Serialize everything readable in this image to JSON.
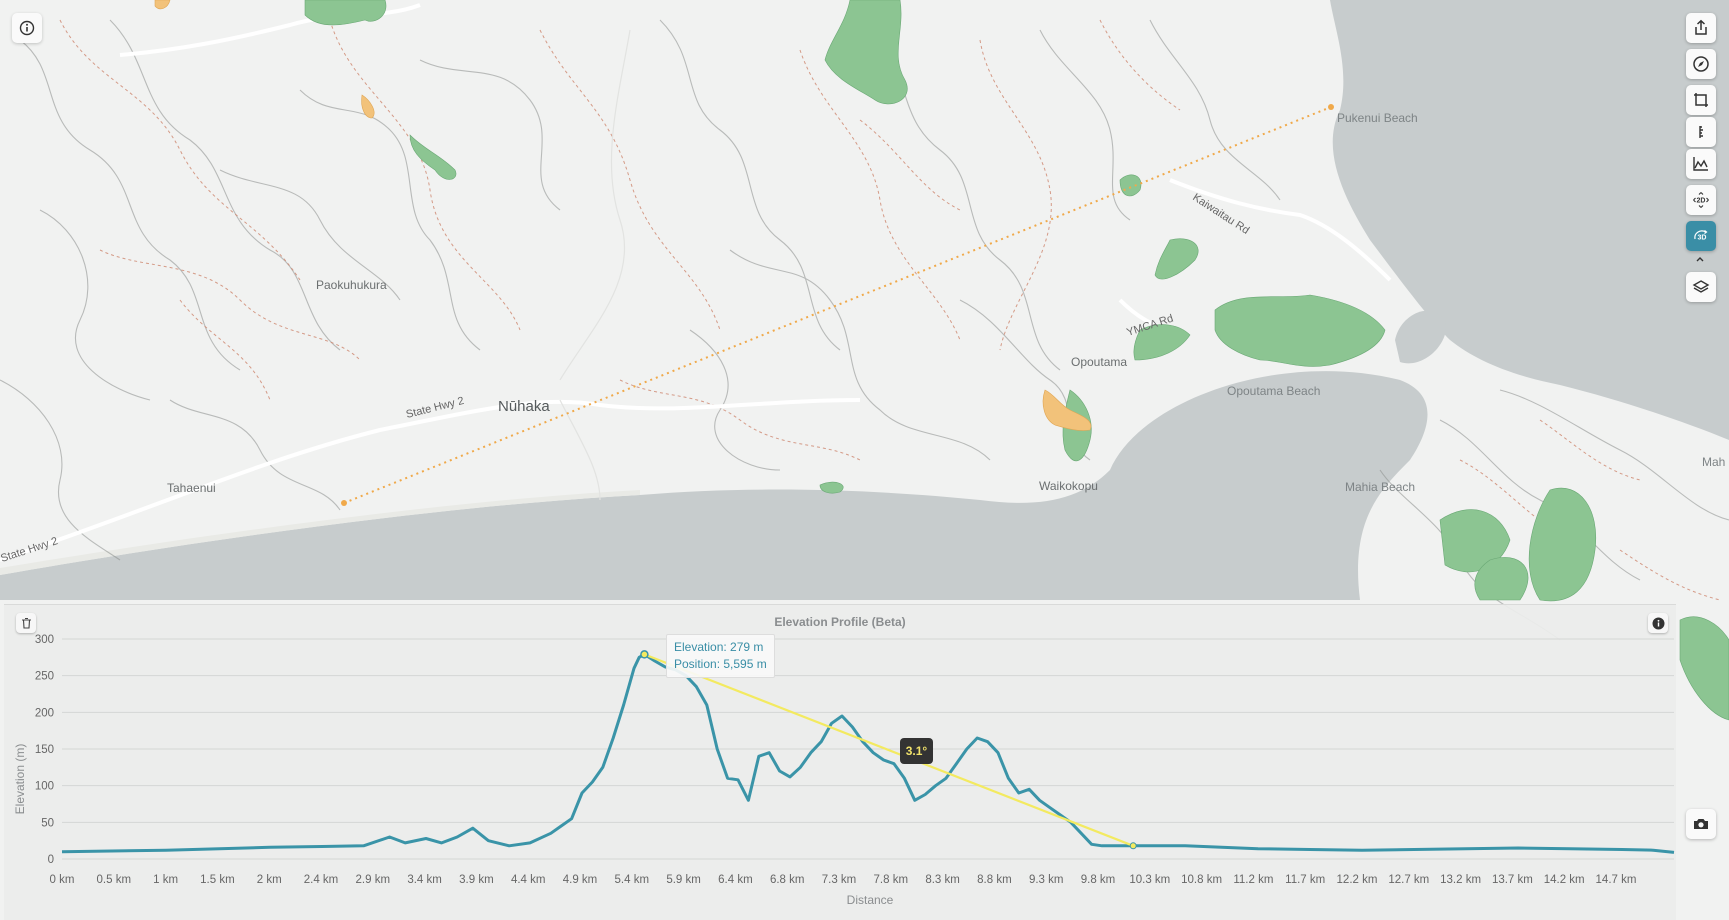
{
  "map": {
    "places": {
      "nuhaka": "Nūhaka",
      "paokuhukura": "Paokuhukura",
      "tahaenui": "Tahaenui",
      "opoutama": "Opoutama",
      "waikokopu": "Waikokopu",
      "pukenui_beach": "Pukenui Beach",
      "opoutama_beach": "Opoutama Beach",
      "mahia_beach": "Mahia Beach",
      "mah": "Mah"
    },
    "roads": {
      "state_hwy_2_a": "State Hwy 2",
      "state_hwy_2_b": "State Hwy 2",
      "kaiwaitau_rd": "Kaiwaitau Rd",
      "ymca_rd": "YMCA Rd"
    },
    "colors": {
      "land": "#f1f2f1",
      "sea": "#c7cccd",
      "forest": "#8cc592",
      "route": "#f0a94a"
    }
  },
  "controls": {
    "info_icon": "info-icon",
    "share_icon": "share-icon",
    "compass_icon": "compass-icon",
    "frame_icon": "frame-icon",
    "ruler_icon": "ruler-icon",
    "profile_icon": "elevation-profile-icon",
    "view_2d_label": "2D",
    "view_3d_label": "3D",
    "layers_icon": "layers-icon",
    "camera_icon": "camera-icon",
    "trash_icon": "trash-icon"
  },
  "elevation_panel": {
    "title": "Elevation Profile (Beta)",
    "tooltip": {
      "elevation": "Elevation: 279 m",
      "position": "Position: 5,595 m"
    },
    "slope_label": "3.1°",
    "colors": {
      "profile": "#3a94a8",
      "slope_line": "#f3ea60"
    }
  },
  "chart_data": {
    "type": "line",
    "xlabel": "Distance",
    "ylabel": "Elevation (m)",
    "xlim": [
      0,
      15.5
    ],
    "ylim": [
      0,
      300
    ],
    "y_ticks": [
      "0",
      "50",
      "100",
      "150",
      "200",
      "250",
      "300"
    ],
    "x_ticks": [
      "0 km",
      "0.5 km",
      "1 km",
      "1.5 km",
      "2 km",
      "2.4 km",
      "2.9 km",
      "3.4 km",
      "3.9 km",
      "4.4 km",
      "4.9 km",
      "5.4 km",
      "5.9 km",
      "6.4 km",
      "6.8 km",
      "7.3 km",
      "7.8 km",
      "8.3 km",
      "8.8 km",
      "9.3 km",
      "9.8 km",
      "10.3 km",
      "10.8 km",
      "11.2 km",
      "11.7 km",
      "12.2 km",
      "12.7 km",
      "13.2 km",
      "13.7 km",
      "14.2 km",
      "14.7 km"
    ],
    "grid": true,
    "series": [
      {
        "x": [
          0,
          1,
          2,
          2.5,
          2.9,
          3.15,
          3.3,
          3.5,
          3.65,
          3.8,
          3.95,
          4.1,
          4.3,
          4.5,
          4.7,
          4.8,
          4.9,
          5.0,
          5.1,
          5.2,
          5.3,
          5.4,
          5.5,
          5.55,
          5.6,
          5.7,
          5.8,
          5.9,
          6.0,
          6.1,
          6.2,
          6.3,
          6.4,
          6.5,
          6.6,
          6.7,
          6.8,
          6.9,
          7.0,
          7.1,
          7.2,
          7.3,
          7.4,
          7.5,
          7.6,
          7.7,
          7.8,
          7.9,
          8.0,
          8.1,
          8.2,
          8.3,
          8.4,
          8.5,
          8.6,
          8.7,
          8.8,
          8.9,
          9.0,
          9.1,
          9.2,
          9.3,
          9.4,
          9.5,
          9.6,
          9.7,
          9.8,
          9.9,
          10.0,
          10.1,
          10.2,
          10.3,
          10.4,
          10.6,
          10.8,
          11.5,
          12.0,
          12.5,
          13.0,
          13.5,
          14.0,
          14.5,
          15.0,
          15.3,
          15.5
        ],
        "y": [
          10,
          12,
          16,
          17,
          18,
          30,
          22,
          28,
          22,
          30,
          42,
          25,
          18,
          22,
          35,
          45,
          55,
          90,
          105,
          125,
          165,
          210,
          260,
          275,
          279,
          270,
          262,
          258,
          250,
          235,
          210,
          150,
          110,
          108,
          80,
          140,
          145,
          120,
          112,
          125,
          145,
          160,
          185,
          195,
          180,
          160,
          145,
          135,
          130,
          110,
          80,
          88,
          100,
          110,
          130,
          150,
          165,
          160,
          145,
          110,
          90,
          95,
          80,
          70,
          60,
          50,
          35,
          20,
          18,
          18,
          18,
          18,
          18,
          18,
          18,
          14,
          13,
          12,
          13,
          14,
          15,
          14,
          13,
          12,
          9
        ]
      }
    ],
    "slope_line": {
      "x": [
        5.6,
        10.3
      ],
      "y": [
        279,
        18
      ]
    }
  }
}
